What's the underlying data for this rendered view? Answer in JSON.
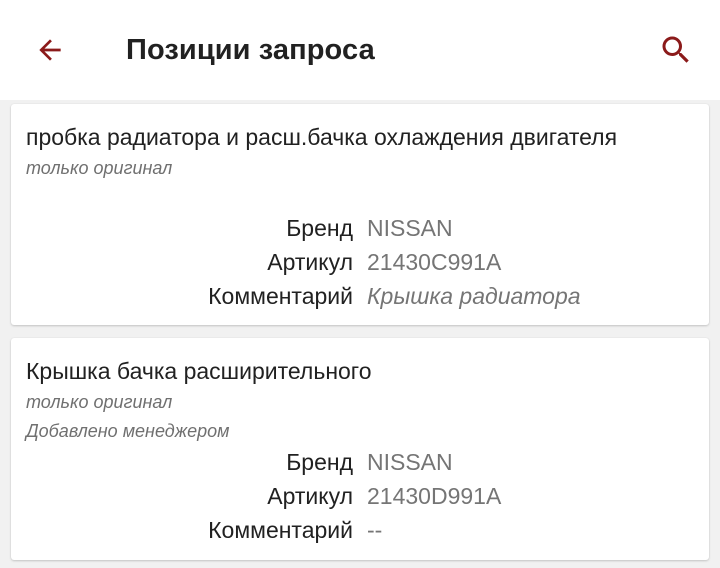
{
  "header": {
    "title": "Позиции запроса",
    "back_icon": "arrow-left-icon",
    "search_icon": "search-icon",
    "accent_color": "#8b1a1a"
  },
  "items": [
    {
      "name": "пробка радиатора и расш.бачка охлаждения двигателя",
      "notes": [
        "только оригинал"
      ],
      "brand_label": "Бренд",
      "brand": "NISSAN",
      "article_label": "Артикул",
      "article": "21430C991A",
      "comment_label": "Комментарий",
      "comment": "Крышка радиатора"
    },
    {
      "name": "Крышка бачка расширительного",
      "notes": [
        "только оригинал",
        "Добавлено менеджером"
      ],
      "brand_label": "Бренд",
      "brand": "NISSAN",
      "article_label": "Артикул",
      "article": "21430D991A",
      "comment_label": "Комментарий",
      "comment": "--"
    }
  ]
}
